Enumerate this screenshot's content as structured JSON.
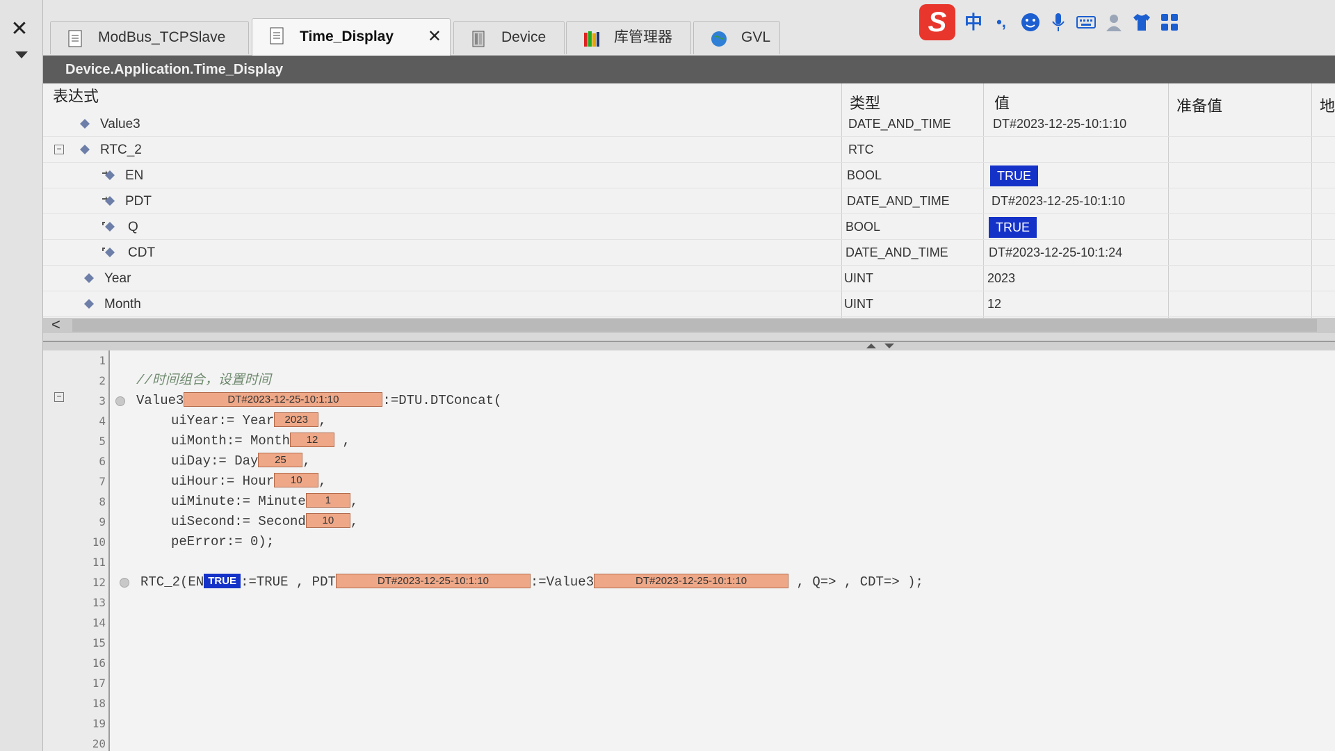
{
  "window": {
    "close_label": "✕"
  },
  "tabs": [
    {
      "label": "ModBus_TCPSlave",
      "icon": "document-icon"
    },
    {
      "label": "Time_Display",
      "icon": "document-icon",
      "active": true,
      "close": "✕"
    },
    {
      "label": "Device",
      "icon": "device-icon"
    },
    {
      "label": "库管理器",
      "icon": "library-books-icon"
    },
    {
      "label": "GVL",
      "icon": "globe-icon"
    }
  ],
  "ime_toolbar": {
    "logo": "S",
    "mode": "中",
    "punct": "•,",
    "icons": [
      "sogou-logo-icon",
      "chinese-mode-icon",
      "punctuation-icon",
      "emoji-icon",
      "microphone-icon",
      "keyboard-icon",
      "user-icon",
      "skin-shirt-icon",
      "apps-grid-icon"
    ]
  },
  "title": "Device.Application.Time_Display",
  "watch": {
    "headers": {
      "expression": "表达式",
      "type": "类型",
      "value": "值",
      "prepared": "准备值",
      "address": "地"
    },
    "rows": [
      {
        "name": "Value3",
        "type": "DATE_AND_TIME",
        "value": "DT#2023-12-25-10:1:10"
      },
      {
        "name": "RTC_2",
        "type": "RTC",
        "value": "",
        "expanded": "−"
      },
      {
        "name": "EN",
        "type": "BOOL",
        "value": "TRUE",
        "highlight": true
      },
      {
        "name": "PDT",
        "type": "DATE_AND_TIME",
        "value": "DT#2023-12-25-10:1:10"
      },
      {
        "name": "Q",
        "type": "BOOL",
        "value": "TRUE",
        "highlight": true
      },
      {
        "name": "CDT",
        "type": "DATE_AND_TIME",
        "value": "DT#2023-12-25-10:1:24"
      },
      {
        "name": "Year",
        "type": "UINT",
        "value": "2023"
      },
      {
        "name": "Month",
        "type": "UINT",
        "value": "12"
      }
    ],
    "scroll_left": "<"
  },
  "editor": {
    "line_numbers": [
      "1",
      "2",
      "3",
      "4",
      "5",
      "6",
      "7",
      "8",
      "9",
      "10",
      "11",
      "12",
      "13",
      "14",
      "15",
      "16",
      "17",
      "18",
      "19",
      "20"
    ],
    "fold": "−",
    "line2_comment": "//时间组合，设置时间",
    "line3": {
      "var": "Value3",
      "mon": "DT#2023-12-25-10:1:10",
      "rest": ":=DTU.DTConcat("
    },
    "line4": {
      "text": "uiYear:= Year",
      "mon": "2023",
      "end": ","
    },
    "line5": {
      "text": "uiMonth:= Month",
      "mon": "12",
      "end": " ,"
    },
    "line6": {
      "text": "uiDay:= Day",
      "mon": "25",
      "end": ","
    },
    "line7": {
      "text": "uiHour:= Hour",
      "mon": "10",
      "end": ","
    },
    "line8": {
      "text": "uiMinute:= Minute",
      "mon": "1",
      "end": ","
    },
    "line9": {
      "text": "uiSecond:= Second",
      "mon": "10",
      "end": ","
    },
    "line10": {
      "text": "peError:= 0);"
    },
    "line12": {
      "a": "RTC_2(EN",
      "en_mon": "TRUE",
      "b": ":=TRUE , PDT",
      "pdt_mon": "DT#2023-12-25-10:1:10",
      "c": ":=Value3",
      "v3_mon": "DT#2023-12-25-10:1:10",
      "d": " , Q=> , CDT=> );"
    }
  },
  "colors": {
    "accent_true": "#1532c8",
    "monitor_bg": "#eea888",
    "titlebar": "#5c5c5c"
  }
}
